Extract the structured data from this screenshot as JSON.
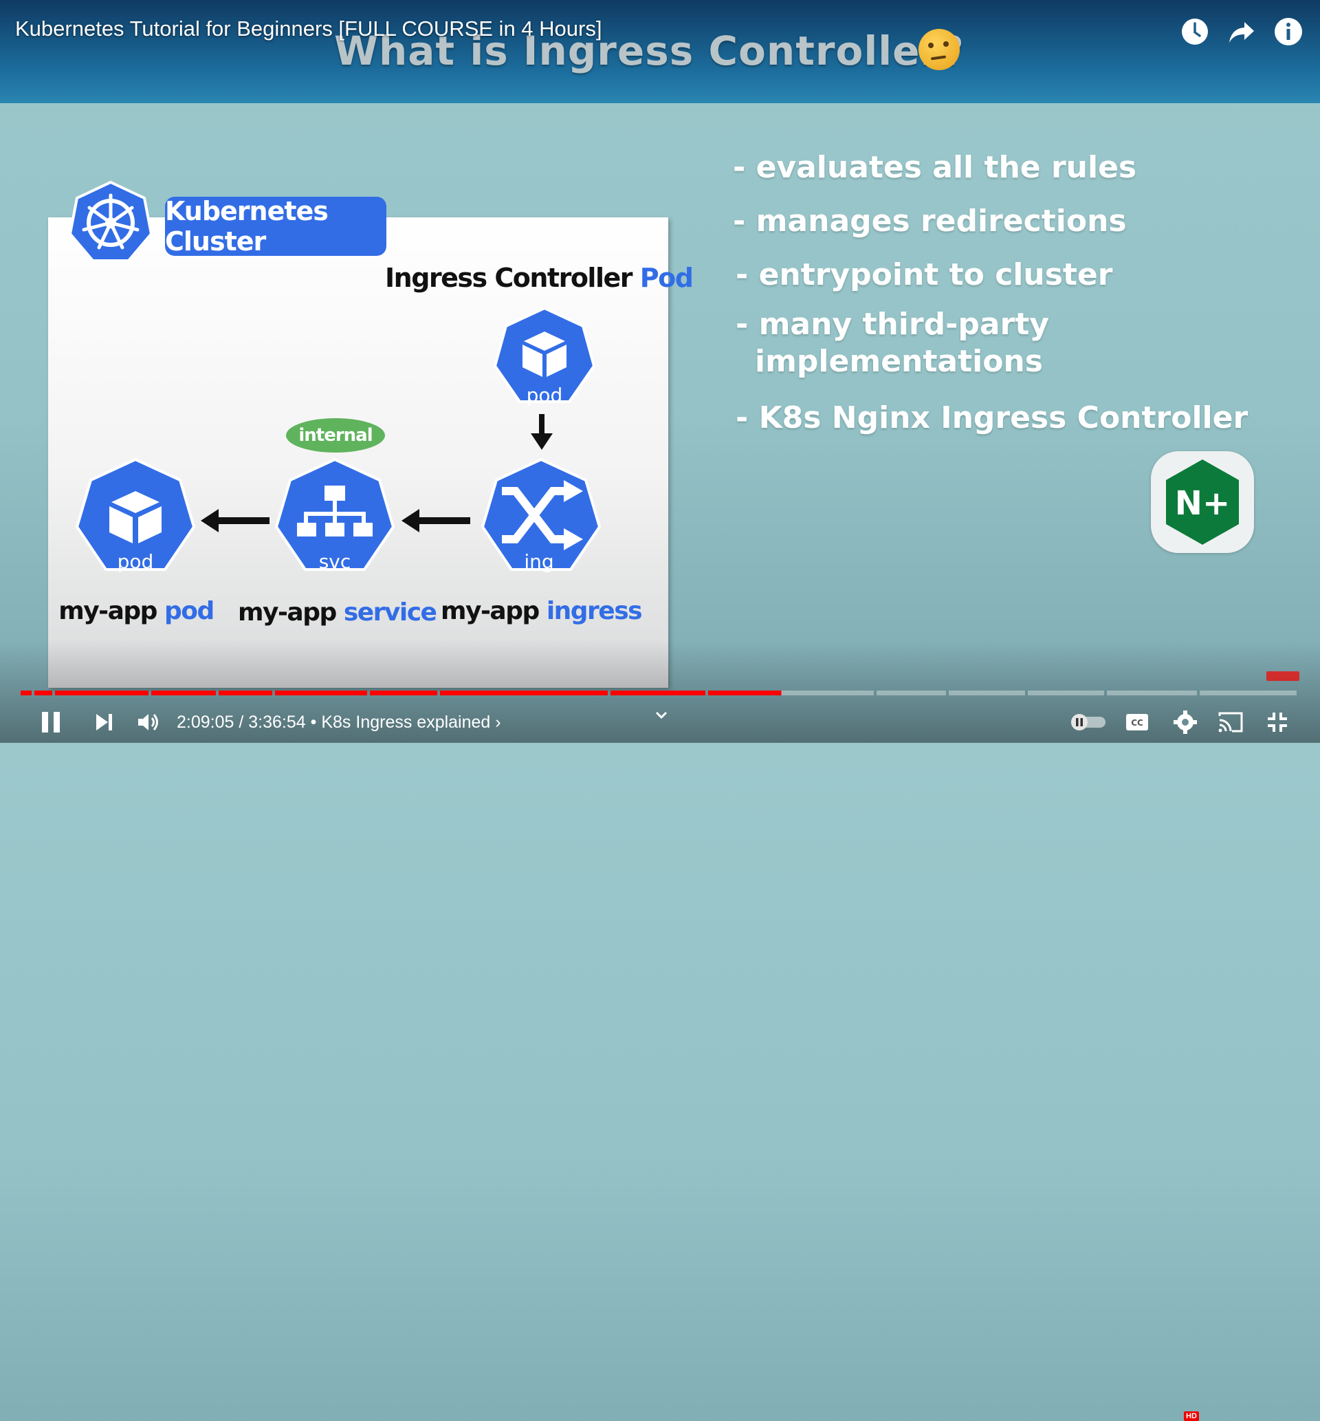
{
  "video": {
    "title": "Kubernetes Tutorial for Beginners [FULL COURSE in 4 Hours]"
  },
  "top_actions": [
    {
      "icon": "clock-icon",
      "label": "Watch later"
    },
    {
      "icon": "share-icon",
      "label": "Share"
    },
    {
      "icon": "info-icon",
      "label": "Info"
    }
  ],
  "slide": {
    "title": "What is Ingress Controller?",
    "title_icon": "thinking-face-icon",
    "cluster_label": "Kubernetes Cluster",
    "controller_label_main": "Ingress Controller",
    "controller_label_accent": "Pod",
    "internal_badge": "internal",
    "pods": {
      "controller_pod_icon_label": "pod",
      "app_pod_icon_label": "pod",
      "svc_icon_label": "svc",
      "ing_icon_label": "ing"
    },
    "resources": [
      {
        "name": "my-app",
        "kind": "pod"
      },
      {
        "name": "my-app",
        "kind": "service"
      },
      {
        "name": "my-app",
        "kind": "ingress"
      }
    ],
    "bullets": [
      "- evaluates all the rules",
      "- manages redirections",
      "- entrypoint to cluster",
      "- many third-party",
      "implementations",
      "- K8s Nginx Ingress Controller"
    ],
    "nginx_logo_text": "N+"
  },
  "player": {
    "current_time": "2:09:05",
    "duration": "3:36:54",
    "time_display": "2:09:05 / 3:36:54",
    "chapter_separator": "•",
    "chapter": "K8s Ingress explained",
    "chapter_chevron": "›",
    "progress_fraction": 0.595,
    "hd_badge": "HD",
    "colors": {
      "played": "#ff0000",
      "unplayed": "rgba(255,255,255,0.35)",
      "accent": "#326de6",
      "internal": "#5fb35c"
    }
  }
}
